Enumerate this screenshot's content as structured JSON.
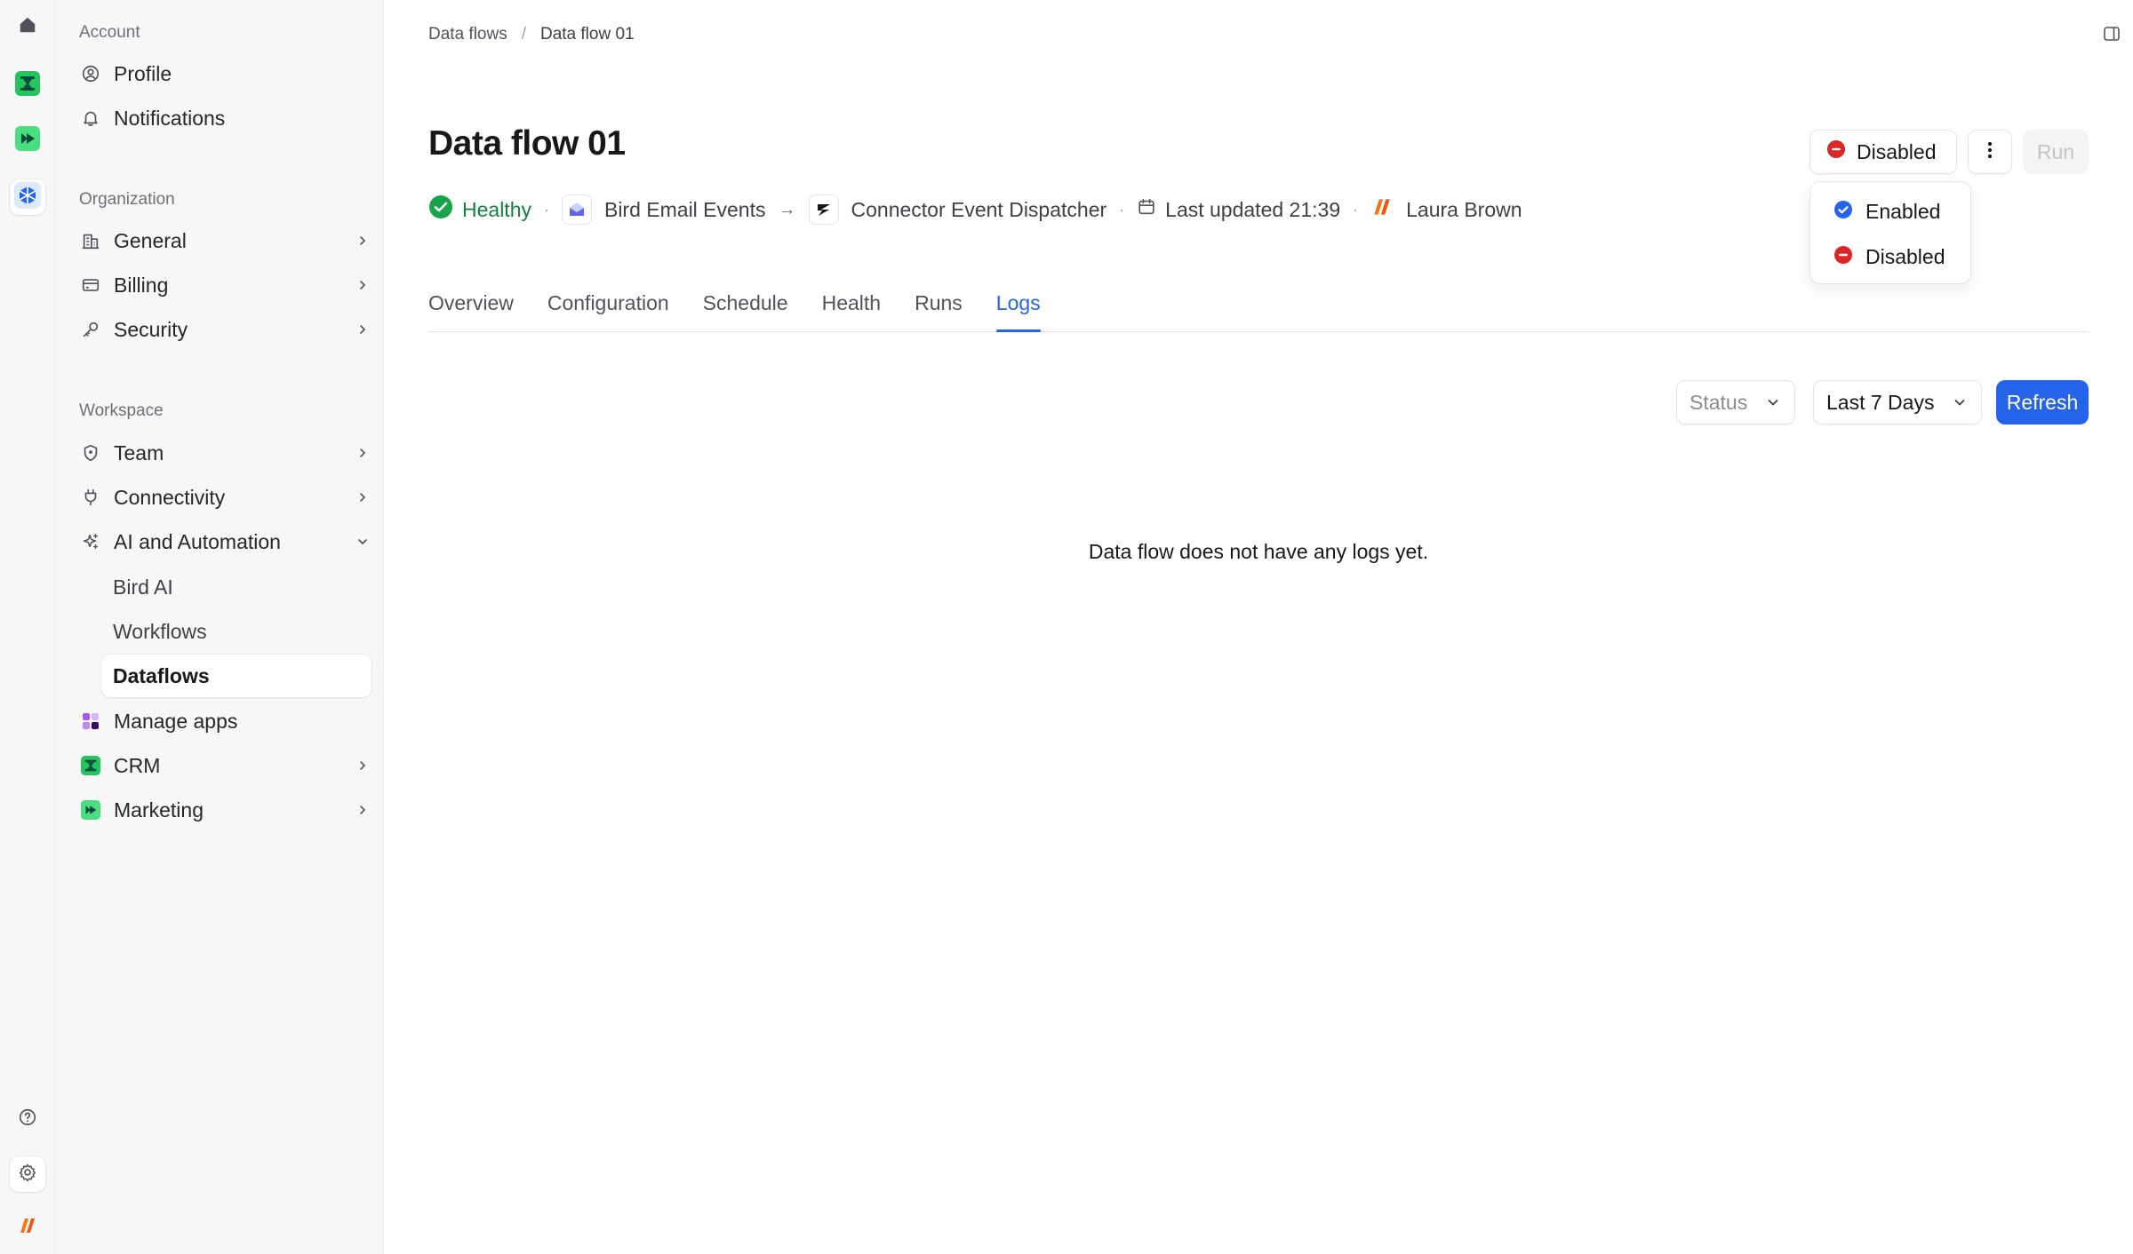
{
  "rail": {
    "items": [
      {
        "icon": "home-icon"
      },
      {
        "icon": "crm-app-icon"
      },
      {
        "icon": "marketing-app-icon"
      },
      {
        "icon": "bird-app-icon"
      }
    ],
    "bottom": [
      {
        "icon": "help-icon"
      },
      {
        "icon": "settings-icon"
      },
      {
        "icon": "org-logo-icon"
      }
    ]
  },
  "sidebar": {
    "account_title": "Account",
    "account_items": [
      {
        "label": "Profile",
        "icon": "user-circle-icon"
      },
      {
        "label": "Notifications",
        "icon": "bell-icon"
      }
    ],
    "organization_title": "Organization",
    "organization_items": [
      {
        "label": "General",
        "icon": "building-icon"
      },
      {
        "label": "Billing",
        "icon": "credit-card-icon"
      },
      {
        "label": "Security",
        "icon": "key-icon"
      }
    ],
    "workspace_title": "Workspace",
    "workspace_items": [
      {
        "label": "Team",
        "icon": "shield-icon"
      },
      {
        "label": "Connectivity",
        "icon": "plug-icon"
      },
      {
        "label": "AI and Automation",
        "icon": "sparkles-icon"
      }
    ],
    "ai_sub_items": [
      {
        "label": "Bird AI"
      },
      {
        "label": "Workflows"
      },
      {
        "label": "Dataflows"
      }
    ],
    "app_items": [
      {
        "label": "Manage apps",
        "icon": "apps-grid-icon"
      },
      {
        "label": "CRM",
        "icon": "crm-app-icon"
      },
      {
        "label": "Marketing",
        "icon": "marketing-app-icon"
      }
    ]
  },
  "breadcrumb": {
    "parent": "Data flows",
    "separator": "/",
    "current": "Data flow 01"
  },
  "page": {
    "title": "Data flow 01",
    "health": "Healthy",
    "source": "Bird Email Events",
    "destination": "Connector Event Dispatcher",
    "last_updated": "Last updated 21:39",
    "owner": "Laura Brown"
  },
  "actions": {
    "status_label": "Disabled",
    "run_label": "Run",
    "status_menu": [
      {
        "label": "Enabled",
        "color": "#2563eb"
      },
      {
        "label": "Disabled",
        "color": "#dc2626"
      }
    ]
  },
  "tabs": [
    {
      "label": "Overview"
    },
    {
      "label": "Configuration"
    },
    {
      "label": "Schedule"
    },
    {
      "label": "Health"
    },
    {
      "label": "Runs"
    },
    {
      "label": "Logs",
      "active": true
    }
  ],
  "filters": {
    "status_placeholder": "Status",
    "date_range": "Last 7 Days",
    "refresh_label": "Refresh"
  },
  "logs": {
    "empty_message": "Data flow does not have any logs yet."
  },
  "colors": {
    "accent": "#2563eb",
    "healthy": "#16a34a",
    "disabled": "#dc2626"
  }
}
